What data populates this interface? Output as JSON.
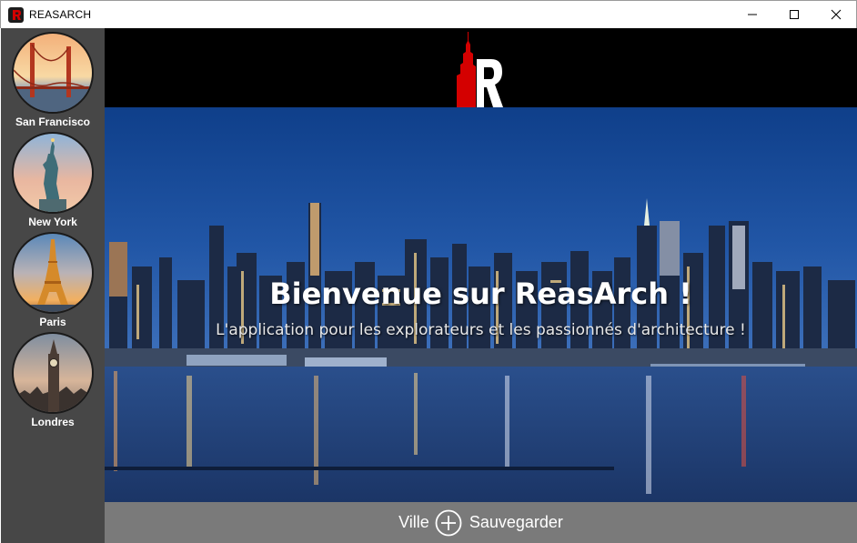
{
  "window": {
    "title": "REASARCH",
    "controls": {
      "minimize": "minimize",
      "maximize": "maximize",
      "close": "close"
    }
  },
  "sidebar": {
    "cities": [
      {
        "label": "San Francisco",
        "icon": "golden-gate-bridge"
      },
      {
        "label": "New York",
        "icon": "statue-of-liberty"
      },
      {
        "label": "Paris",
        "icon": "eiffel-tower"
      },
      {
        "label": "Londres",
        "icon": "big-ben"
      }
    ]
  },
  "hero": {
    "title": "Bienvenue sur ReasArch !",
    "subtitle": "L'application pour les explorateurs et les passionnés d'architecture !"
  },
  "footer": {
    "city_label": "Ville",
    "save_label": "Sauvegarder"
  },
  "colors": {
    "accent": "#d40000",
    "sidebar": "#474747",
    "footer": "#7a7a7a"
  }
}
